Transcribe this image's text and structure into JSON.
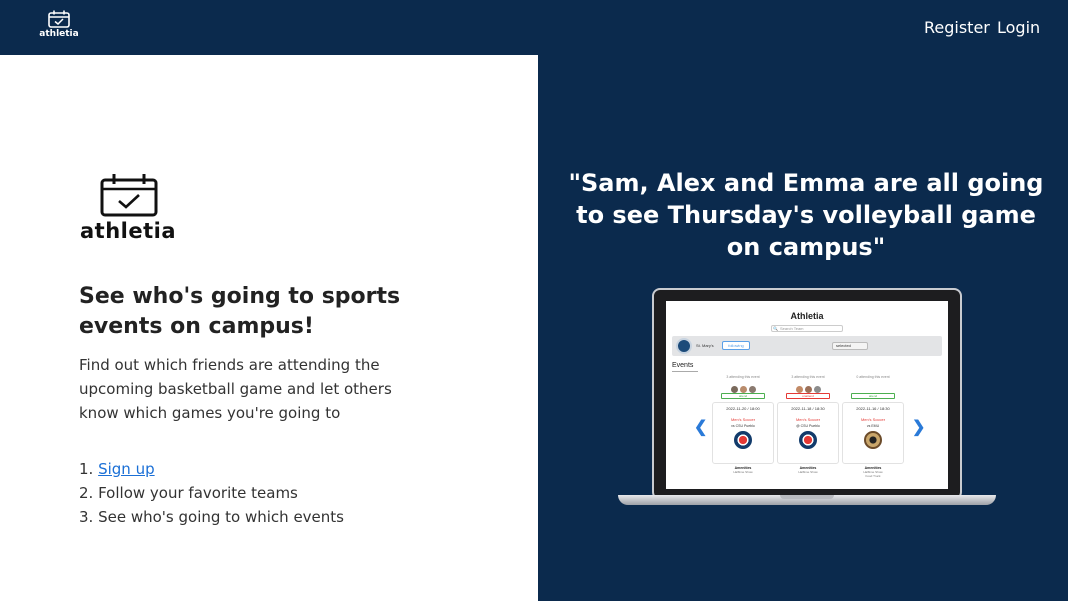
{
  "nav": {
    "logo_text": "athletia",
    "register": "Register",
    "login": "Login"
  },
  "hero": {
    "logo_text": "athletia",
    "headline": "See who's going to sports events on campus!",
    "description": "Find out which friends are attending the upcoming basketball game and let others know which games you're going to",
    "steps": [
      {
        "number": "1.",
        "text": "Sign up",
        "is_link": true
      },
      {
        "number": "2.",
        "text": "Follow your favorite teams"
      },
      {
        "number": "3.",
        "text": "See who's going to which events"
      }
    ]
  },
  "showcase": {
    "quote": "\"Sam, Alex and Emma are all going to see Thursday's volleyball game on campus\"",
    "preview": {
      "title": "Athletia",
      "search_placeholder": "Search Team",
      "team_name": "St. Mary's",
      "follow_label": "following",
      "select_label": "selected",
      "events_label": "Events",
      "cards": [
        {
          "attending": "3 attending this event",
          "button": "attend",
          "date": "2022-11-20   /   18:00",
          "event": "Men's Soccer",
          "opponent": "vs CSU Pueblo",
          "amenities": "Amenities",
          "amenities_detail": "Halftime Show"
        },
        {
          "attending": "3 attending this event",
          "button": "unattend",
          "date": "2022-11-18   /   18:30",
          "event": "Men's Soccer",
          "opponent": "@ CSU Pueblo",
          "amenities": "Amenities",
          "amenities_detail": "Halftime Show"
        },
        {
          "attending": "0 attending this event",
          "button": "attend",
          "date": "2022-11-16   /   18:30",
          "event": "Men's Soccer",
          "opponent": "vs EMU",
          "amenities": "Amenities",
          "amenities_detail": "Halftime Show",
          "amenities_detail2": "Food Truck"
        }
      ]
    }
  },
  "colors": {
    "navy": "#0b2a4d",
    "link": "#1a6fd6",
    "accent_red": "#e53935",
    "accent_green": "#4caf50"
  }
}
